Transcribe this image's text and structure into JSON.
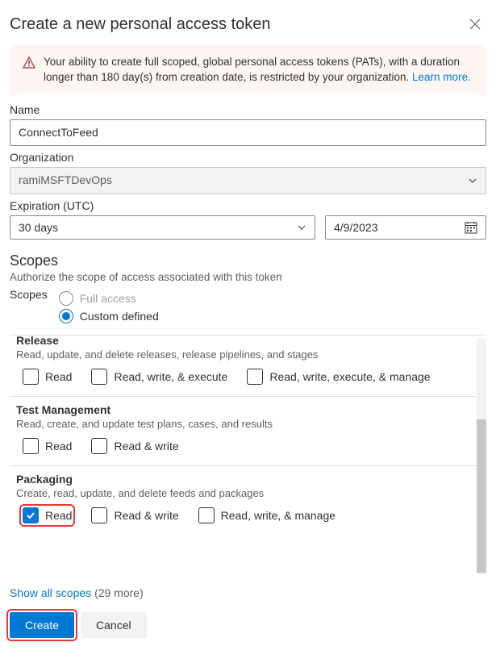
{
  "header": {
    "title": "Create a new personal access token"
  },
  "banner": {
    "text": "Your ability to create full scoped, global personal access tokens (PATs), with a duration longer than 180 day(s) from creation date, is restricted by your organization. ",
    "link_text": "Learn more."
  },
  "name_field": {
    "label": "Name",
    "value": "ConnectToFeed"
  },
  "org_field": {
    "label": "Organization",
    "value": "ramiMSFTDevOps"
  },
  "expiration": {
    "label": "Expiration (UTC)",
    "preset": "30 days",
    "date": "4/9/2023"
  },
  "scopes": {
    "heading": "Scopes",
    "subheading": "Authorize the scope of access associated with this token",
    "label": "Scopes",
    "option_full": "Full access",
    "option_custom": "Custom defined"
  },
  "groups": {
    "release": {
      "title": "Release",
      "desc": "Read, update, and delete releases, release pipelines, and stages",
      "perms": [
        "Read",
        "Read, write, & execute",
        "Read, write, execute, & manage"
      ]
    },
    "test": {
      "title": "Test Management",
      "desc": "Read, create, and update test plans, cases, and results",
      "perms": [
        "Read",
        "Read & write"
      ]
    },
    "packaging": {
      "title": "Packaging",
      "desc": "Create, read, update, and delete feeds and packages",
      "perms": [
        "Read",
        "Read & write",
        "Read, write, & manage"
      ]
    }
  },
  "show_all": {
    "link": "Show all scopes",
    "count": "(29 more)"
  },
  "buttons": {
    "create": "Create",
    "cancel": "Cancel"
  }
}
